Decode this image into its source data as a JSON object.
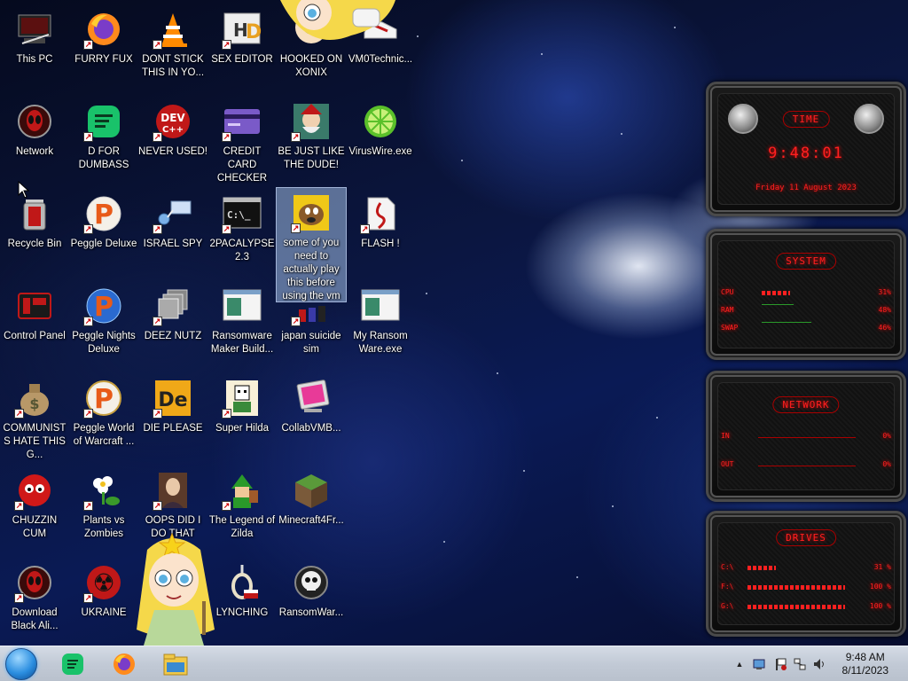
{
  "desktop": {
    "icons": [
      {
        "label": "This PC"
      },
      {
        "label": "FURRY FUX"
      },
      {
        "label": "DONT STICK THIS IN YO..."
      },
      {
        "label": "SEX EDITOR"
      },
      {
        "label": "HOOKED ON XONIX"
      },
      {
        "label": "VM0Technic..."
      },
      {
        "label": "Network"
      },
      {
        "label": "D FOR DUMBASS"
      },
      {
        "label": "NEVER USED!"
      },
      {
        "label": "CREDIT CARD CHECKER"
      },
      {
        "label": "BE JUST LIKE THE DUDE!"
      },
      {
        "label": "VirusWire.exe"
      },
      {
        "label": "Recycle Bin"
      },
      {
        "label": "Peggle Deluxe"
      },
      {
        "label": "ISRAEL SPY"
      },
      {
        "label": "2PACALYPSE 2.3"
      },
      {
        "label": "some of you need to actually play this before using the vm"
      },
      {
        "label": "FLASH !"
      },
      {
        "label": "Control Panel"
      },
      {
        "label": "Peggle Nights Deluxe"
      },
      {
        "label": "DEEZ NUTZ"
      },
      {
        "label": "Ransomware Maker Build..."
      },
      {
        "label": "japan suicide sim"
      },
      {
        "label": "My Ransom Ware.exe"
      },
      {
        "label": "COMMUNISTS HATE THIS G..."
      },
      {
        "label": "Peggle World of Warcraft ..."
      },
      {
        "label": "DIE PLEASE"
      },
      {
        "label": "Super Hilda"
      },
      {
        "label": "CollabVMB..."
      },
      {
        "label": "CHUZZIN CUM"
      },
      {
        "label": "Plants vs Zombies"
      },
      {
        "label": "OOPS DID I DO THAT"
      },
      {
        "label": "The Legend of Zilda"
      },
      {
        "label": "Minecraft4Fr..."
      },
      {
        "label": "Download Black Ali..."
      },
      {
        "label": "UKRAINE"
      },
      {
        "label": "LYNCHING"
      },
      {
        "label": "RansomWar..."
      }
    ],
    "icon_glyphs": {
      "dev": "DEV",
      "dev_sub": "C++",
      "de": "De",
      "cmd": "C:\\_",
      "radiation": "☢",
      "money": "$"
    }
  },
  "gadget": {
    "time": {
      "title": "TIME",
      "clock": "9:48:01",
      "date": "Friday 11 August 2023"
    },
    "system": {
      "title": "SYSTEM",
      "rows": [
        {
          "label": "CPU",
          "value": "31%",
          "level": 0.31
        },
        {
          "label": "RAM",
          "value": "48%",
          "level": 0.48
        },
        {
          "label": "SWAP",
          "value": "46%",
          "level": 0.46
        }
      ]
    },
    "network": {
      "title": "NETWORK",
      "rows": [
        {
          "label": "IN",
          "value": "0%"
        },
        {
          "label": "OUT",
          "value": "0%"
        }
      ]
    },
    "drives": {
      "title": "DRIVES",
      "rows": [
        {
          "label": "C:\\",
          "value": "31 %",
          "level": 0.31
        },
        {
          "label": "F:\\",
          "value": "100 %",
          "level": 1.0
        },
        {
          "label": "G:\\",
          "value": "100 %",
          "level": 1.0
        }
      ]
    }
  },
  "taskbar": {
    "pinned": [
      "Start",
      "D FOR DUMBASS",
      "Firefox",
      "File Explorer"
    ],
    "clock_time": "9:48 AM",
    "clock_date": "8/11/2023",
    "tray_chevron": "▲",
    "tray_icons": [
      "network-icon",
      "flag-icon",
      "connection-icon",
      "volume-icon"
    ]
  },
  "colors": {
    "gadget_red": "#ff2020",
    "taskbar": "#c2cad6",
    "selection": "#a0bee6"
  }
}
